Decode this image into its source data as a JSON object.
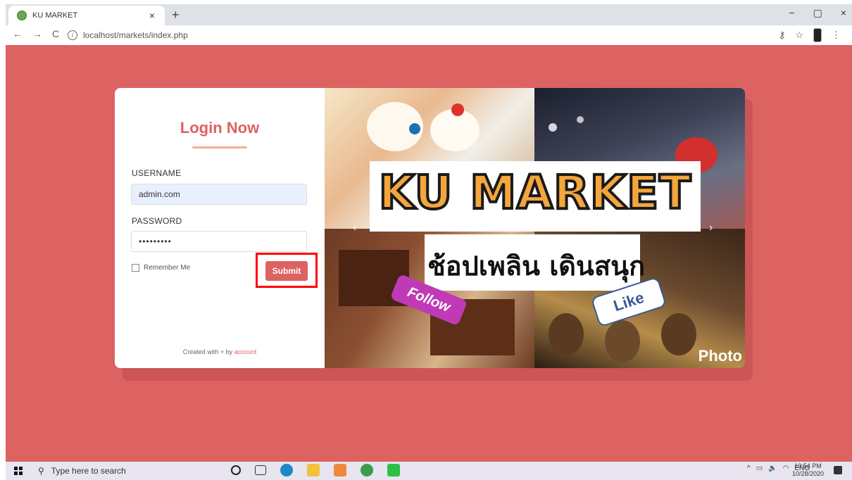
{
  "browser": {
    "tab_title": "KU MARKET",
    "tab_close": "×",
    "new_tab": "+",
    "url": "localhost/markets/index.php",
    "nav_back": "←",
    "nav_forward": "→",
    "nav_reload": "C",
    "win_min": "−",
    "win_max": "▢",
    "win_close": "×"
  },
  "login": {
    "heading": "Login Now",
    "username_label": "USERNAME",
    "username_value": "admin.com",
    "password_label": "PASSWORD",
    "password_value": "•••••••••",
    "remember_label": "Remember Me",
    "submit_label": "Submit",
    "footer_prefix": "Created with",
    "footer_heart": "♥",
    "footer_by": "by",
    "footer_link": "account"
  },
  "banner": {
    "title": "KU MARKET",
    "subtitle": "ช้อปเพลิน เดินสนุก",
    "follow": "Follow",
    "like": "Like",
    "watermark": "Photo",
    "prev": "‹",
    "next": "›"
  },
  "taskbar": {
    "search_placeholder": "Type here to search",
    "tray_lang": "ENG",
    "time": "10:54 PM",
    "date": "10/28/2020"
  },
  "colors": {
    "page_bg": "#dd6262",
    "accent": "#dd6262",
    "underline": "#f4b084",
    "highlight": "#ff0000"
  }
}
